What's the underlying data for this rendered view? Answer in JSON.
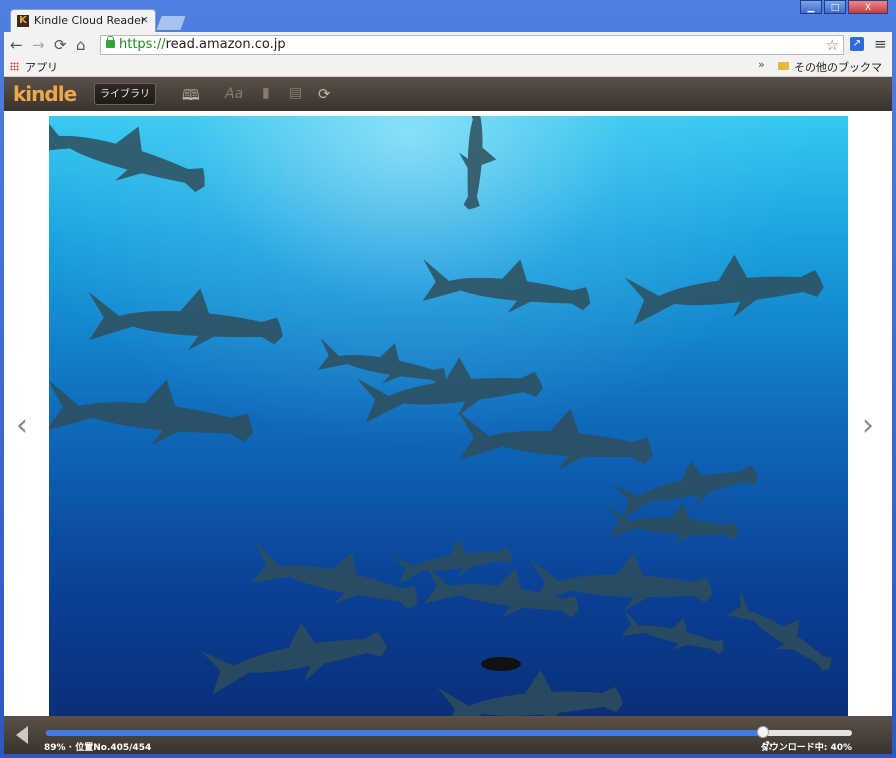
{
  "browser": {
    "tab_title": "Kindle Cloud Reader",
    "tab_close": "×",
    "window_buttons": [
      "▁",
      "□",
      "X"
    ],
    "nav": {
      "back": "←",
      "forward": "→",
      "reload": "⟳",
      "home": "⌂"
    },
    "url_scheme": "https://",
    "url_host": "read.amazon.co.jp",
    "star": "☆",
    "menu": "≡",
    "bookmarks": {
      "apps_label": "アプリ",
      "overflow": "»",
      "other_label": "その他のブックマーク"
    }
  },
  "kindle": {
    "logo": "kindle",
    "library_button": "ライブラリ",
    "toolbar_icons": [
      "book-open-icon",
      "font-settings-icon",
      "bookmark-icon",
      "notes-icon",
      "sync-icon"
    ]
  },
  "reader": {
    "prev_page": "‹",
    "next_page": "›"
  },
  "footer": {
    "progress_percent": 89,
    "location_text": "89% · 位置No.405/454",
    "download_text": "ダウンロード中: 40%"
  },
  "colors": {
    "kindle_orange": "#f0a74b",
    "progress_blue": "#3f7be0",
    "header_brown": "#4a413a"
  }
}
